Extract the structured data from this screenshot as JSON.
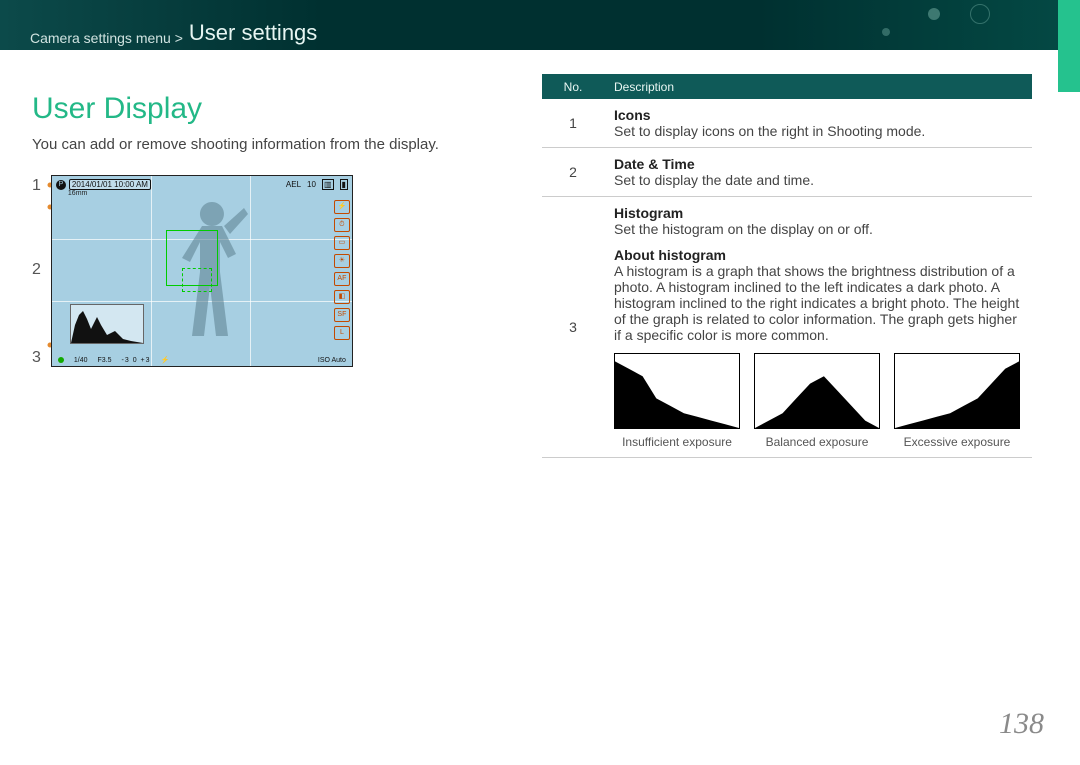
{
  "breadcrumb": {
    "path": "Camera settings menu >",
    "current": "User settings"
  },
  "section_title": "User Display",
  "intro": "You can add or remove shooting information from the display.",
  "callouts": [
    "1",
    "2",
    "3"
  ],
  "lcd": {
    "date": "2014/01/01 10:00 AM",
    "lens": "16mm",
    "ael": "AEL",
    "shots": "10",
    "shutter": "1/40",
    "aperture": "F3.5",
    "scale": "-3   0   +3",
    "iso": "ISO Auto"
  },
  "table": {
    "head": {
      "no": "No.",
      "desc": "Description"
    },
    "rows": [
      {
        "no": "1",
        "title": "Icons",
        "body": "Set to display icons on the right in Shooting mode."
      },
      {
        "no": "2",
        "title": "Date & Time",
        "body": "Set to display the date and time."
      }
    ],
    "histogram": {
      "no": "3",
      "title": "Histogram",
      "body": "Set the histogram on the display on or off.",
      "about_title": "About histogram",
      "about_body": "A histogram is a graph that shows the brightness distribution of a photo. A histogram inclined to the left indicates a dark photo. A histogram inclined to the right indicates a bright photo. The height of the graph is related to color information. The graph gets higher if a specific color is more common.",
      "captions": [
        "Insufficient exposure",
        "Balanced exposure",
        "Excessive exposure"
      ]
    }
  },
  "chart_data": [
    {
      "type": "area",
      "title": "Insufficient exposure",
      "x": [
        0,
        1,
        2,
        3,
        4,
        5,
        6,
        7,
        8,
        9
      ],
      "values": [
        9,
        8,
        7,
        4,
        3,
        2,
        1.5,
        1,
        0.5,
        0
      ],
      "xlabel": "",
      "ylabel": "",
      "ylim": [
        0,
        10
      ]
    },
    {
      "type": "area",
      "title": "Balanced exposure",
      "x": [
        0,
        1,
        2,
        3,
        4,
        5,
        6,
        7,
        8,
        9
      ],
      "values": [
        0,
        1,
        2,
        4,
        6,
        7,
        5,
        3,
        1,
        0
      ],
      "xlabel": "",
      "ylabel": "",
      "ylim": [
        0,
        10
      ]
    },
    {
      "type": "area",
      "title": "Excessive exposure",
      "x": [
        0,
        1,
        2,
        3,
        4,
        5,
        6,
        7,
        8,
        9
      ],
      "values": [
        0,
        0.5,
        1,
        1.5,
        2,
        3,
        4,
        6,
        8,
        9
      ],
      "xlabel": "",
      "ylabel": "",
      "ylim": [
        0,
        10
      ]
    }
  ],
  "page_number": "138"
}
